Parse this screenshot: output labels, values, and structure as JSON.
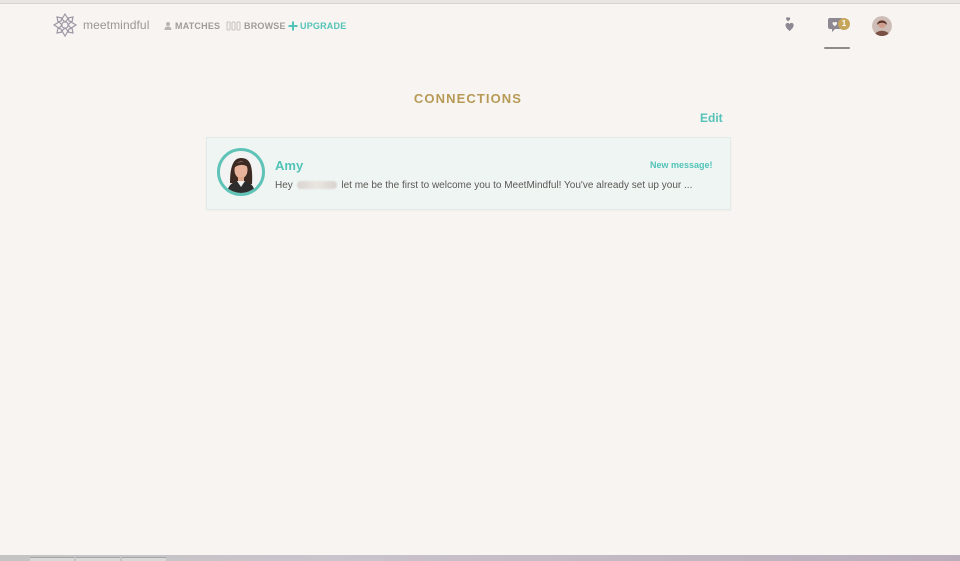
{
  "app": {
    "brand": "meetmindful"
  },
  "nav": {
    "matches": "MATCHES",
    "browse": "BROWSE",
    "upgrade": "UPGRADE"
  },
  "header": {
    "message_badge": "1"
  },
  "connections": {
    "title": "CONNECTIONS",
    "edit_label": "Edit",
    "items": [
      {
        "name": "Amy",
        "status": "New message!",
        "preview_prefix": "Hey",
        "preview_suffix": "let me be the first to welcome you to MeetMindful! You've already set up your ..."
      }
    ]
  },
  "colors": {
    "accent": "#53c3b8",
    "heading": "#b79a56",
    "background": "#f8f4f1",
    "badge": "#c5a65a"
  },
  "icons": {
    "logo": "meetmindful-logo-icon",
    "matches": "person-icon",
    "browse": "grid-icon",
    "upgrade": "plus-icon",
    "likes": "hearts-icon",
    "messages": "message-icon",
    "profile": "avatar-icon"
  }
}
